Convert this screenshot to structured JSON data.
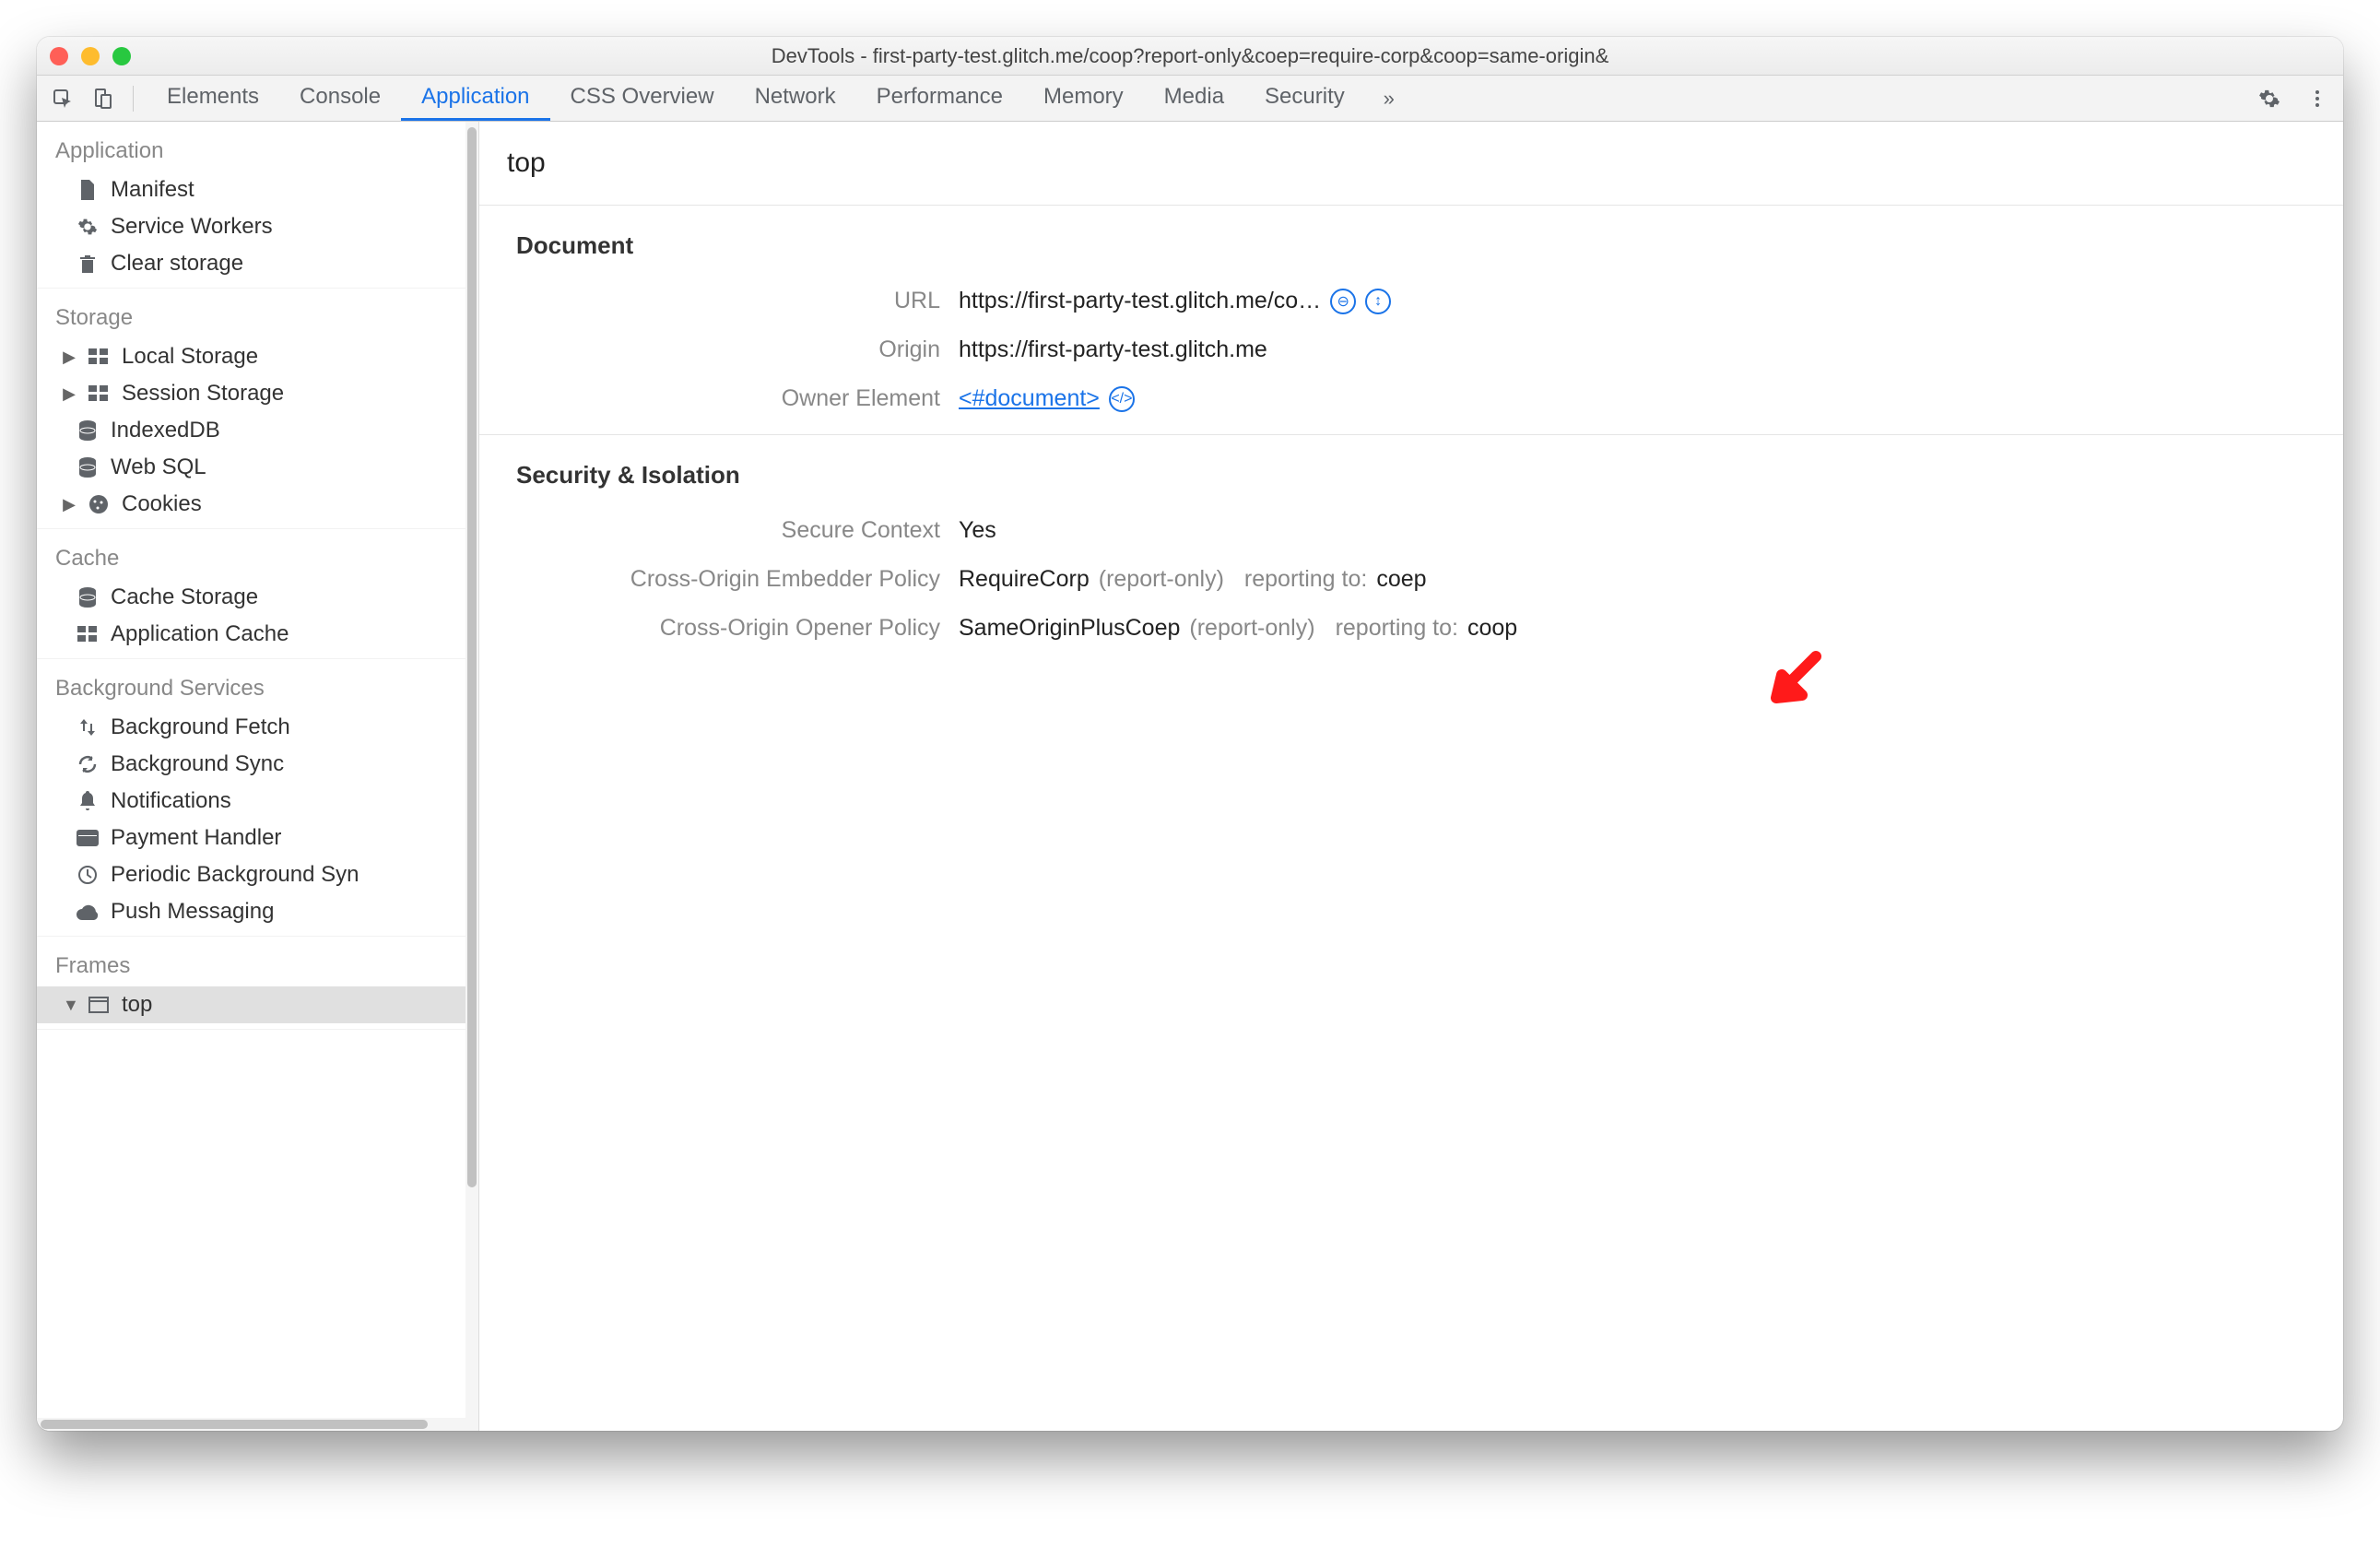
{
  "window": {
    "title": "DevTools - first-party-test.glitch.me/coop?report-only&coep=require-corp&coop=same-origin&"
  },
  "tabs": {
    "items": [
      "Elements",
      "Console",
      "Application",
      "CSS Overview",
      "Network",
      "Performance",
      "Memory",
      "Media",
      "Security"
    ],
    "active_index": 2
  },
  "sidebar": {
    "groups": [
      {
        "header": "Application",
        "items": [
          {
            "icon": "file",
            "label": "Manifest"
          },
          {
            "icon": "gear",
            "label": "Service Workers"
          },
          {
            "icon": "trash",
            "label": "Clear storage"
          }
        ]
      },
      {
        "header": "Storage",
        "items": [
          {
            "icon": "grid",
            "label": "Local Storage",
            "expandable": true
          },
          {
            "icon": "grid",
            "label": "Session Storage",
            "expandable": true
          },
          {
            "icon": "db",
            "label": "IndexedDB"
          },
          {
            "icon": "db",
            "label": "Web SQL"
          },
          {
            "icon": "cookie",
            "label": "Cookies",
            "expandable": true
          }
        ]
      },
      {
        "header": "Cache",
        "items": [
          {
            "icon": "db",
            "label": "Cache Storage"
          },
          {
            "icon": "grid",
            "label": "Application Cache"
          }
        ]
      },
      {
        "header": "Background Services",
        "items": [
          {
            "icon": "updown",
            "label": "Background Fetch"
          },
          {
            "icon": "sync",
            "label": "Background Sync"
          },
          {
            "icon": "bell",
            "label": "Notifications"
          },
          {
            "icon": "card",
            "label": "Payment Handler"
          },
          {
            "icon": "clock",
            "label": "Periodic Background Syn"
          },
          {
            "icon": "cloud",
            "label": "Push Messaging"
          }
        ]
      },
      {
        "header": "Frames",
        "items": [
          {
            "icon": "frame",
            "label": "top",
            "expanded": true,
            "selected": true
          }
        ]
      }
    ]
  },
  "main": {
    "title": "top",
    "document": {
      "section_title": "Document",
      "url_label": "URL",
      "url_value": "https://first-party-test.glitch.me/co…",
      "origin_label": "Origin",
      "origin_value": "https://first-party-test.glitch.me",
      "owner_label": "Owner Element",
      "owner_value": "<#document>"
    },
    "security": {
      "section_title": "Security & Isolation",
      "secure_label": "Secure Context",
      "secure_value": "Yes",
      "coep_label": "Cross-Origin Embedder Policy",
      "coep_value": "RequireCorp",
      "coep_mode": "(report-only)",
      "coep_report_label": "reporting to:",
      "coep_report_value": "coep",
      "coop_label": "Cross-Origin Opener Policy",
      "coop_value": "SameOriginPlusCoep",
      "coop_mode": "(report-only)",
      "coop_report_label": "reporting to:",
      "coop_report_value": "coop"
    }
  }
}
